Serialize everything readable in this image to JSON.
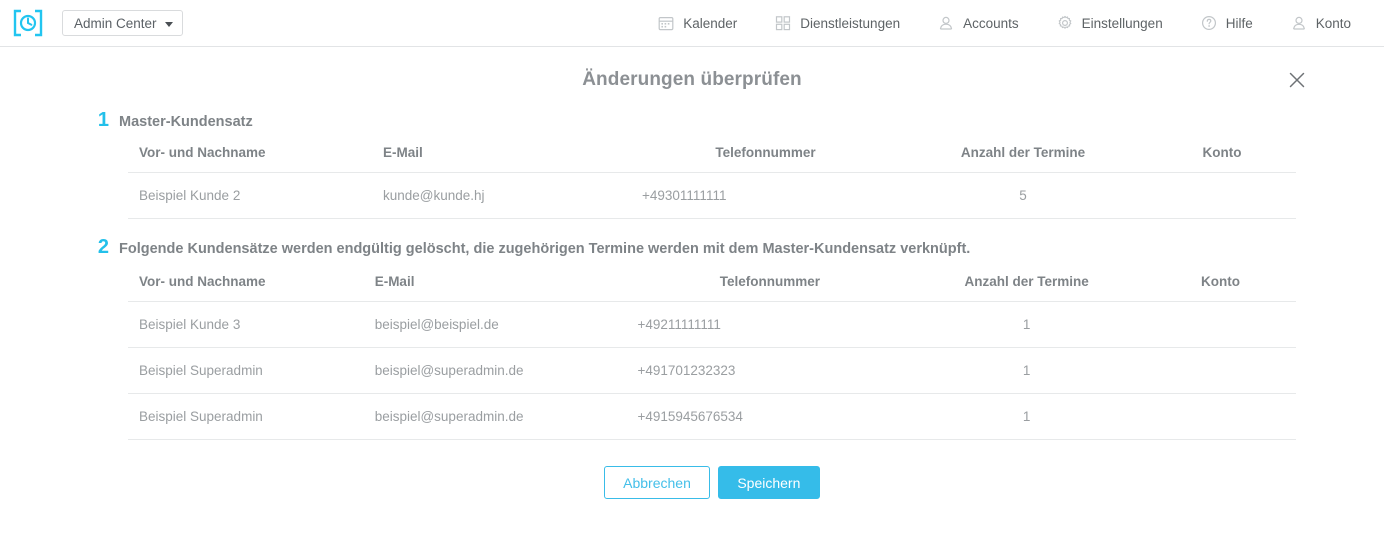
{
  "header": {
    "logo_icon": "clock-in-brackets-logo",
    "brand_label": "Admin Center",
    "nav": [
      {
        "label": "Kalender",
        "icon": "calendar-icon"
      },
      {
        "label": "Dienstleistungen",
        "icon": "grid-squares-icon"
      },
      {
        "label": "Accounts",
        "icon": "user-group-icon"
      },
      {
        "label": "Einstellungen",
        "icon": "gear-icon"
      },
      {
        "label": "Hilfe",
        "icon": "question-circle-icon"
      },
      {
        "label": "Konto",
        "icon": "user-icon"
      }
    ]
  },
  "modal": {
    "title": "Änderungen überprüfen",
    "close_icon": "close-icon",
    "sections": [
      {
        "number": "1",
        "title": "Master-Kundensatz",
        "columns": [
          "Vor- und Nachname",
          "E-Mail",
          "Telefonnummer",
          "Anzahl der Termine",
          "Konto"
        ],
        "rows": [
          {
            "name": "Beispiel Kunde 2",
            "email": "kunde@kunde.hj",
            "phone": "+49301111111",
            "appointments": "5",
            "account": ""
          }
        ]
      },
      {
        "number": "2",
        "title": "Folgende Kundensätze werden endgültig gelöscht, die zugehörigen Termine werden mit dem Master-Kundensatz verknüpft.",
        "columns": [
          "Vor- und Nachname",
          "E-Mail",
          "Telefonnummer",
          "Anzahl der Termine",
          "Konto"
        ],
        "rows": [
          {
            "name": "Beispiel Kunde 3",
            "email": "beispiel@beispiel.de",
            "phone": "+49211111111",
            "appointments": "1",
            "account": ""
          },
          {
            "name": "Beispiel Superadmin",
            "email": "beispiel@superadmin.de",
            "phone": "+491701232323",
            "appointments": "1",
            "account": ""
          },
          {
            "name": "Beispiel Superadmin",
            "email": "beispiel@superadmin.de",
            "phone": "+4915945676534",
            "appointments": "1",
            "account": ""
          }
        ]
      }
    ],
    "cancel_label": "Abbrechen",
    "save_label": "Speichern"
  },
  "colors": {
    "accent": "#35bce9",
    "step_number": "#23c0ea",
    "text_muted": "#9a9ea1",
    "heading": "#7e8387"
  }
}
